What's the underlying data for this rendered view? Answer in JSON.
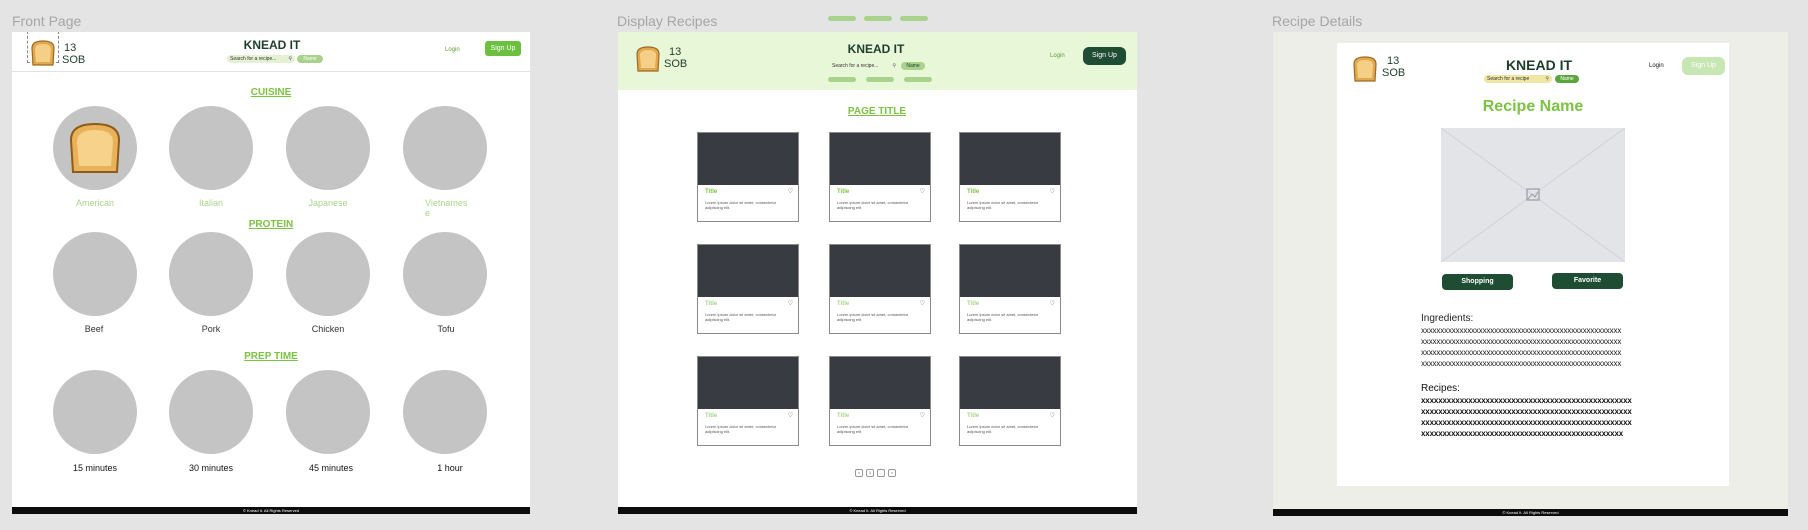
{
  "frames": {
    "front": "Front Page",
    "display": "Display Recipes",
    "details": "Recipe Details"
  },
  "header": {
    "logo_number": "13",
    "logo_text": "SOB",
    "brand": "KNEAD IT",
    "search_placeholder": "Search for a recipe...",
    "search_placeholder_short": "Search for a recipe",
    "filter_label": "Name",
    "login": "Login",
    "signup": "Sign Up"
  },
  "front": {
    "cuisine_title": "CUISINE",
    "cuisines": [
      "American",
      "Italian",
      "Japanese",
      "Vietnamese"
    ],
    "protein_title": "PROTEIN",
    "proteins": [
      "Beef",
      "Pork",
      "Chicken",
      "Tofu"
    ],
    "prep_title": "PREP TIME",
    "prep_times": [
      "15 minutes",
      "30 minutes",
      "45 minutes",
      "1 hour"
    ]
  },
  "display": {
    "page_title": "PAGE TITLE",
    "card_title": "Title",
    "card_desc": "Lorem ipsum dolor sit amet, consectetur adipiscing elit.",
    "pagination": [
      "<",
      "1",
      "...",
      ">"
    ]
  },
  "details": {
    "recipe_name": "Recipe Name",
    "shopping": "Shopping",
    "favorite": "Favorite",
    "ingredients_label": "Ingredients:",
    "ingredient_lines": [
      "xxxxxxxxxxxxxxxxxxxxxxxxxxxxxxxxxxxxxxxxxxxxxxxxxxxx",
      "xxxxxxxxxxxxxxxxxxxxxxxxxxxxxxxxxxxxxxxxxxxxxxxxxxxx",
      "xxxxxxxxxxxxxxxxxxxxxxxxxxxxxxxxxxxxxxxxxxxxxxxxxxxx",
      "xxxxxxxxxxxxxxxxxxxxxxxxxxxxxxxxxxxxxxxxxxxxxxxxxxxx"
    ],
    "recipes_label": "Recipes:",
    "recipe_lines": [
      "xxxxxxxxxxxxxxxxxxxxxxxxxxxxxxxxxxxxxxxxxxxxxxxxx",
      "xxxxxxxxxxxxxxxxxxxxxxxxxxxxxxxxxxxxxxxxxxxxxxxxx",
      "xxxxxxxxxxxxxxxxxxxxxxxxxxxxxxxxxxxxxxxxxxxxxxxxx",
      "xxxxxxxxxxxxxxxxxxxxxxxxxxxxxxxxxxxxxxxxxxxxxxx"
    ]
  },
  "footer": "© Knead It. All Rights Reserved",
  "colors": {
    "accent_green": "#7cc243",
    "dark_green": "#1f4d34",
    "brand_text": "#1f3d2b",
    "header_bg_display": "#e9f7d9",
    "card_image": "#383b42"
  },
  "icons": [
    "toast-logo-icon",
    "search-icon",
    "heart-icon",
    "image-placeholder-icon"
  ]
}
